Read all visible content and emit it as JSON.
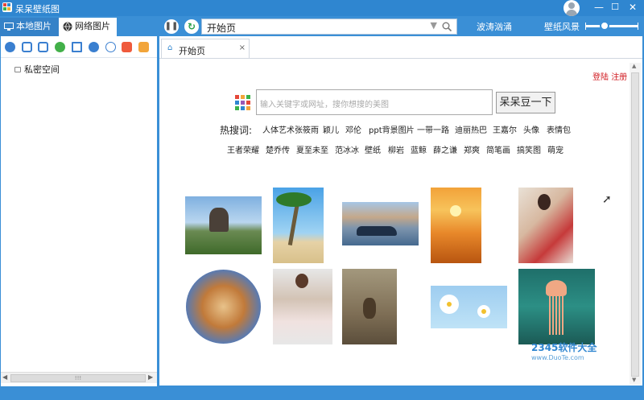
{
  "window": {
    "title": "呆呆壁纸图",
    "min": "—",
    "max": "☐",
    "close": "✕"
  },
  "tabs": {
    "local": "本地图片",
    "network": "网络图片"
  },
  "address": {
    "value": "开始页"
  },
  "top_links": {
    "left": "波涛汹涌",
    "right": "壁纸风景"
  },
  "left": {
    "private_space": "私密空间"
  },
  "page_tab": {
    "label": "开始页",
    "close": "×"
  },
  "auth": {
    "login": "登陆",
    "register": "注册"
  },
  "search": {
    "placeholder": "输入关键字或网址，搜你想搜的美图",
    "button": "呆呆豆一下"
  },
  "hot_label": "热搜词:",
  "hot_row1": [
    "人体艺术张筱雨",
    "颖儿",
    "邓伦",
    "ppt背景图片",
    "一带一路",
    "迪丽热巴",
    "王嘉尔",
    "头像",
    "表情包"
  ],
  "hot_row2": [
    "王者荣耀",
    "楚乔传",
    "夏至未至",
    "范冰冰",
    "壁纸",
    "柳岩",
    "蓝鲸",
    "薛之谦",
    "郑爽",
    "简笔画",
    "搞笑图",
    "萌宠"
  ],
  "watermark": {
    "top": "2345软件大全",
    "bottom": "www.DuoTe.com"
  },
  "hscroll_grip": "!!!",
  "colors": {
    "accent": "#3a8fd6",
    "login_red": "#d0191f"
  }
}
